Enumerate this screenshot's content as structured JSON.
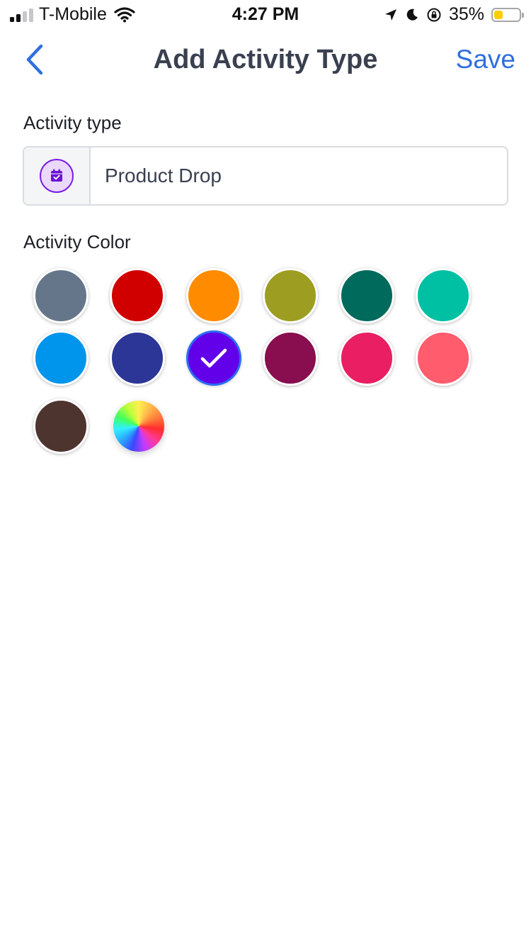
{
  "status": {
    "carrier": "T-Mobile",
    "time": "4:27 PM",
    "battery": "35%",
    "battery_level": 0.35
  },
  "nav": {
    "back_icon": "chevron-left-icon",
    "title": "Add Activity Type",
    "save": "Save"
  },
  "form": {
    "type_label": "Activity type",
    "type_value": "Product Drop",
    "type_icon": "calendar-check-icon",
    "color_label": "Activity Color"
  },
  "colors": [
    {
      "hex": "#66768a",
      "selected": false
    },
    {
      "hex": "#d10000",
      "selected": false
    },
    {
      "hex": "#ff8c00",
      "selected": false
    },
    {
      "hex": "#9d9d22",
      "selected": false
    },
    {
      "hex": "#006b5c",
      "selected": false
    },
    {
      "hex": "#00c0a4",
      "selected": false
    },
    {
      "hex": "#0095ec",
      "selected": false
    },
    {
      "hex": "#2c3696",
      "selected": false
    },
    {
      "hex": "#6200ea",
      "selected": true
    },
    {
      "hex": "#880e4f",
      "selected": false
    },
    {
      "hex": "#e91e63",
      "selected": false
    },
    {
      "hex": "#ff5c6e",
      "selected": false
    },
    {
      "hex": "#4e342e",
      "selected": false
    }
  ],
  "custom_color_icon": "color-wheel-icon"
}
